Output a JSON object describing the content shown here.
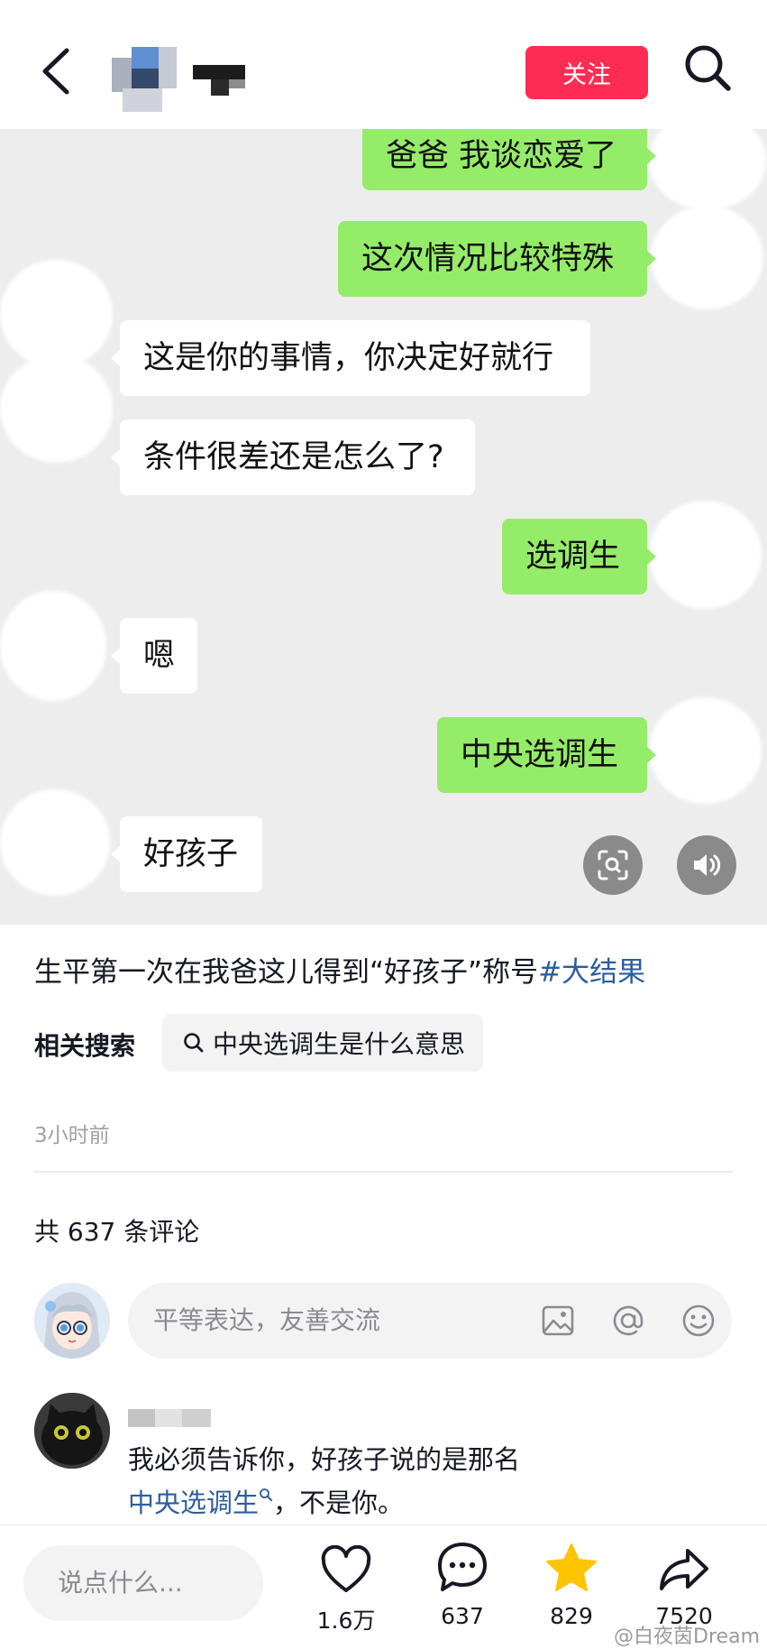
{
  "header": {
    "follow_label": "关注"
  },
  "chat": {
    "messages": [
      {
        "side": "me",
        "text": "爸爸 我谈恋爱了"
      },
      {
        "side": "me",
        "text": "这次情况比较特殊"
      },
      {
        "side": "other",
        "text": "这是你的事情，你决定好就行"
      },
      {
        "side": "other",
        "text": "条件很差还是怎么了?"
      },
      {
        "side": "me",
        "text": "选调生"
      },
      {
        "side": "other",
        "text": "嗯"
      },
      {
        "side": "me",
        "text": "中央选调生"
      },
      {
        "side": "other",
        "text": "好孩子"
      }
    ],
    "controls": {
      "ocr_icon": "scan-text-icon",
      "sound_icon": "speaker-icon"
    }
  },
  "post": {
    "caption": "生平第一次在我爸这儿得到“好孩子”称号",
    "hashtag": "#大结果",
    "related_label": "相关搜索",
    "related_query": "中央选调生是什么意思",
    "timestamp": "3小时前"
  },
  "comments": {
    "count_label": "共 637 条评论",
    "input_placeholder": "平等表达，友善交流",
    "input_icons": [
      "image-icon",
      "at-icon",
      "emoji-icon"
    ],
    "items": [
      {
        "text_before": "我必须告诉你，好孩子说的是那名",
        "link": "中央选调生",
        "text_after": "，不是你。"
      }
    ]
  },
  "bottom_bar": {
    "input_placeholder": "说点什么...",
    "like_count": "1.6万",
    "comment_count": "637",
    "favorite_count": "829",
    "share_count": "7520"
  },
  "watermark": "@白夜茵Dream",
  "colors": {
    "accent": "#fe2c55",
    "chat_me": "#95ec69",
    "link": "#2d5d9b",
    "favorite": "#fdc400"
  }
}
